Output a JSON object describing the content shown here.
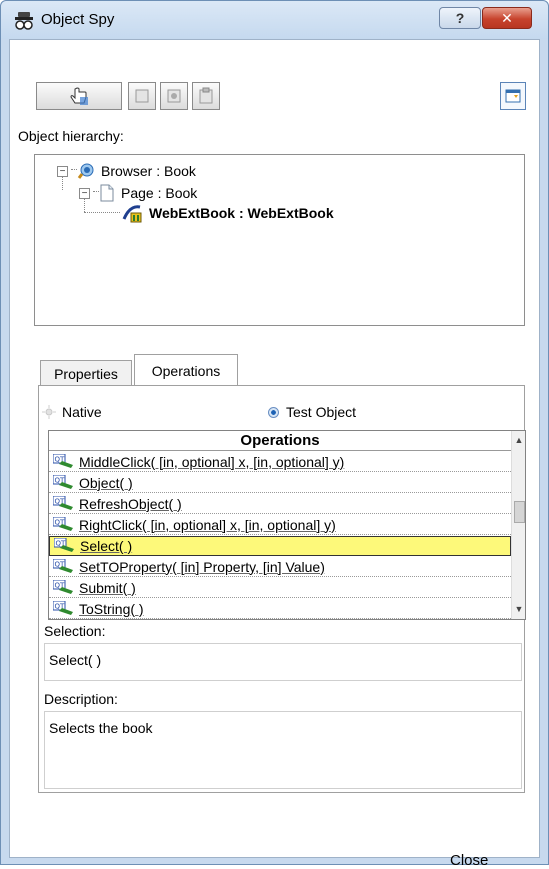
{
  "window": {
    "title": "Object Spy",
    "help_button": "?",
    "close_button": "✕"
  },
  "hierarchy": {
    "label": "Object hierarchy:",
    "nodes": [
      {
        "label": "Browser : Book",
        "expander": "−",
        "icon": "browser-icon"
      },
      {
        "label": "Page : Book",
        "expander": "−",
        "icon": "page-icon"
      },
      {
        "label": "WebExtBook : WebExtBook",
        "icon": "webext-object-icon"
      }
    ]
  },
  "tabs": {
    "properties": "Properties",
    "operations": "Operations"
  },
  "mode": {
    "native": "Native",
    "test_object": "Test Object"
  },
  "operations": {
    "header": "Operations",
    "items": [
      "MiddleClick( [in, optional] x, [in, optional] y)",
      "Object( )",
      "RefreshObject( )",
      "RightClick( [in, optional] x, [in, optional] y)",
      "Select( )",
      "SetTOProperty( [in] Property, [in] Value)",
      "Submit( )",
      "ToString( )"
    ],
    "selected_index": 4
  },
  "selection": {
    "label": "Selection:",
    "value": "Select( )"
  },
  "description": {
    "label": "Description:",
    "value": "Selects the book"
  },
  "footer": {
    "close_label": "Close"
  },
  "colors": {
    "selected_row": "#fdf97a",
    "frame": "#c7d9ee"
  }
}
